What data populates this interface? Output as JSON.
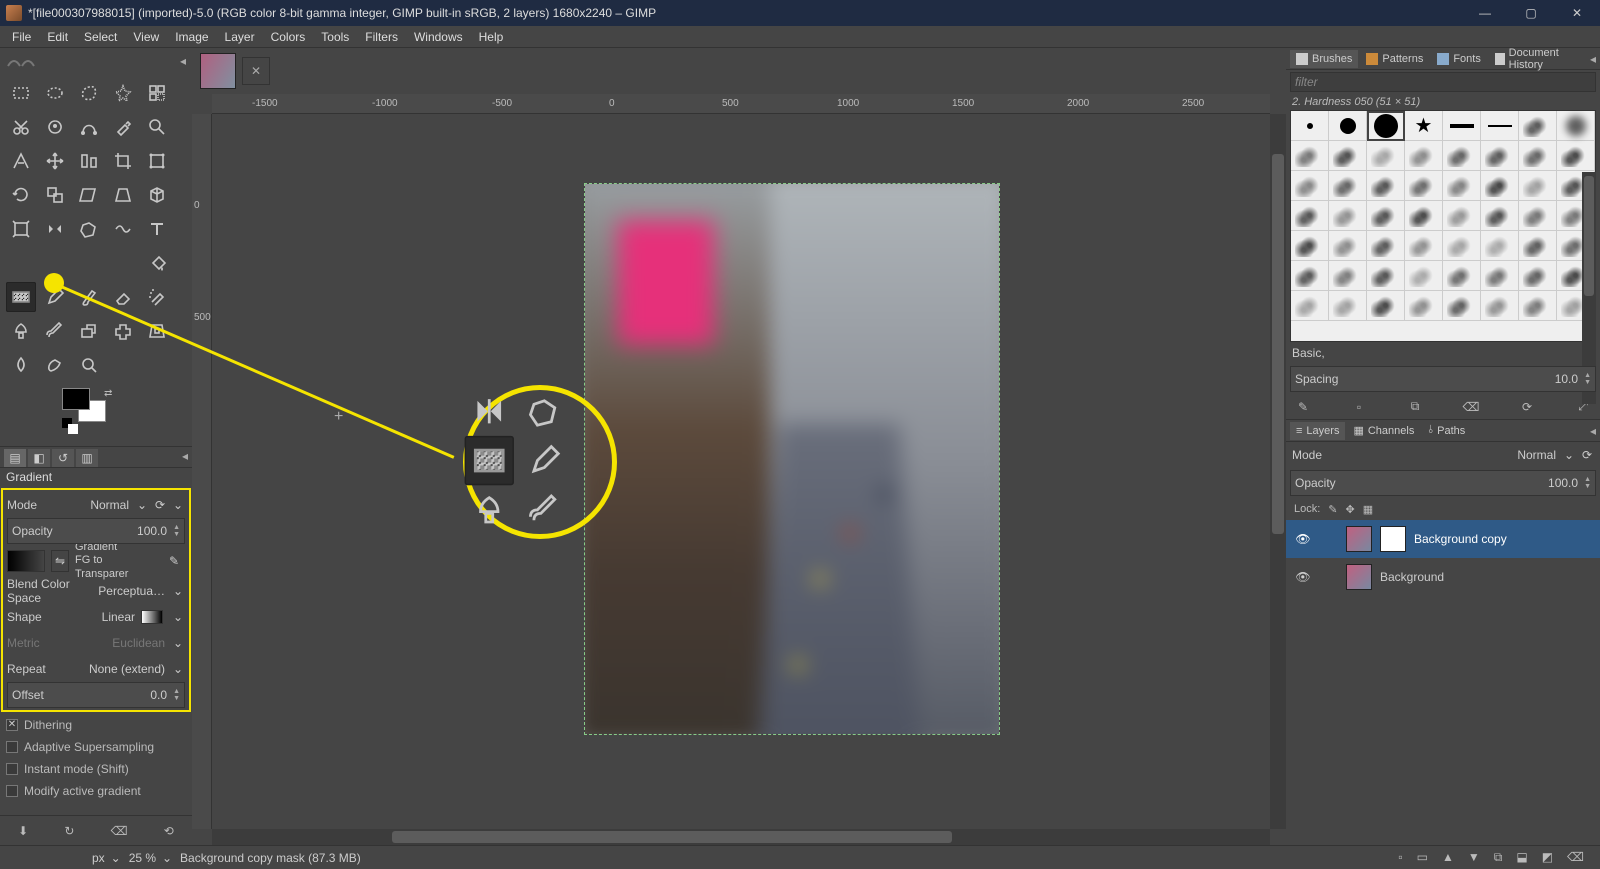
{
  "titlebar": {
    "title": "*[file000307988015] (imported)-5.0 (RGB color 8-bit gamma integer, GIMP built-in sRGB, 2 layers) 1680x2240 – GIMP"
  },
  "menubar": [
    "File",
    "Edit",
    "Select",
    "View",
    "Image",
    "Layer",
    "Colors",
    "Tools",
    "Filters",
    "Windows",
    "Help"
  ],
  "ruler_h": [
    "-1500",
    "-1000",
    "-500",
    "0",
    "500",
    "1000",
    "1500",
    "2000",
    "2500"
  ],
  "ruler_v": [
    "0",
    "500"
  ],
  "tool_options": {
    "title": "Gradient",
    "mode_label": "Mode",
    "mode_value": "Normal",
    "opacity_label": "Opacity",
    "opacity_value": "100.0",
    "gradient_label": "Gradient",
    "gradient_name": "FG to Transparer",
    "blend_label": "Blend Color Space",
    "blend_value": "Perceptua…",
    "shape_label": "Shape",
    "shape_value": "Linear",
    "metric_label": "Metric",
    "metric_value": "Euclidean",
    "repeat_label": "Repeat",
    "repeat_value": "None (extend)",
    "offset_label": "Offset",
    "offset_value": "0.0",
    "dithering_label": "Dithering",
    "adaptive_label": "Adaptive Supersampling",
    "instant_label": "Instant mode  (Shift)",
    "modify_label": "Modify active gradient"
  },
  "right": {
    "tabs": [
      "Brushes",
      "Patterns",
      "Fonts",
      "Document History"
    ],
    "filter_placeholder": "filter",
    "brush_title": "2. Hardness 050 (51 × 51)",
    "basic_label": "Basic,",
    "spacing_label": "Spacing",
    "spacing_value": "10.0",
    "layer_tabs": [
      "Layers",
      "Channels",
      "Paths"
    ],
    "layer_mode_label": "Mode",
    "layer_mode_value": "Normal",
    "layer_opacity_label": "Opacity",
    "layer_opacity_value": "100.0",
    "lock_label": "Lock:",
    "layers": [
      {
        "name": "Background copy"
      },
      {
        "name": "Background"
      }
    ]
  },
  "footer": {
    "unit": "px",
    "zoom": "25 %",
    "status": "Background copy mask (87.3 MB)"
  }
}
